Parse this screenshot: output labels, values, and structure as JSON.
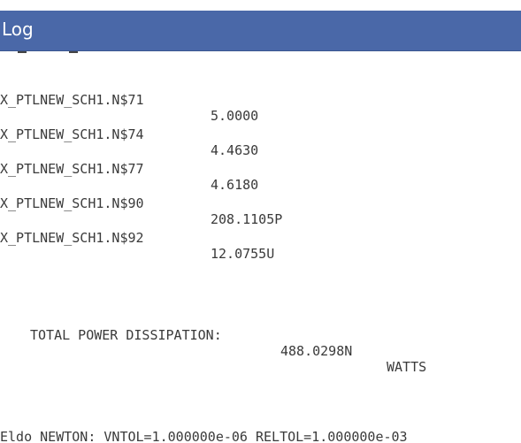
{
  "window": {
    "title": "Log",
    "title_bg": "#4a68a8"
  },
  "log": {
    "rows": [
      {
        "node": "X_PTLNEW_SCH1.N$71",
        "value": "5.0000"
      },
      {
        "node": "X_PTLNEW_SCH1.N$74",
        "value": "4.4630"
      },
      {
        "node": "X_PTLNEW_SCH1.N$77",
        "value": "4.6180"
      },
      {
        "node": "X_PTLNEW_SCH1.N$90",
        "value": "208.1105P"
      },
      {
        "node": "X_PTLNEW_SCH1.N$92",
        "value": "12.0755U"
      }
    ],
    "power": {
      "label": "TOTAL POWER DISSIPATION:",
      "value": "488.0298N",
      "unit": "WATTS"
    },
    "newton_line": "Eldo NEWTON: VNTOL=1.000000e-06 RELTOL=1.000000e-03"
  }
}
